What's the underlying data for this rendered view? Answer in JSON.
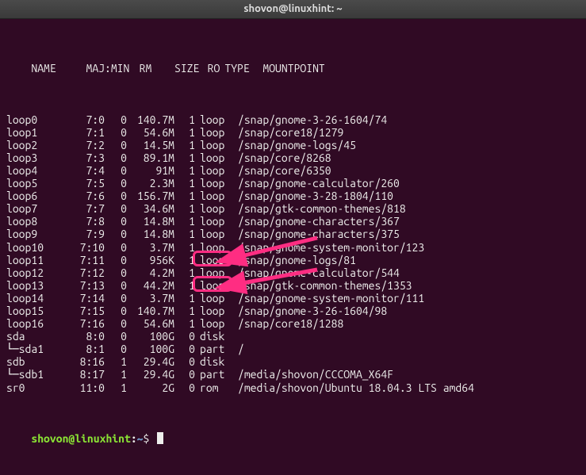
{
  "window": {
    "title": "shovon@linuxhint: ~"
  },
  "header": {
    "name": "NAME",
    "majmin": "MAJ:MIN",
    "rm": "RM",
    "size": "SIZE",
    "ro": "RO",
    "type": "TYPE",
    "mountpoint": "MOUNTPOINT"
  },
  "rows": [
    {
      "name": "loop0",
      "majmin": "7:0",
      "rm": "0",
      "size": "140.7M",
      "ro": "1",
      "type": "loop",
      "mnt": "/snap/gnome-3-26-1604/74"
    },
    {
      "name": "loop1",
      "majmin": "7:1",
      "rm": "0",
      "size": "54.6M",
      "ro": "1",
      "type": "loop",
      "mnt": "/snap/core18/1279"
    },
    {
      "name": "loop2",
      "majmin": "7:2",
      "rm": "0",
      "size": "14.5M",
      "ro": "1",
      "type": "loop",
      "mnt": "/snap/gnome-logs/45"
    },
    {
      "name": "loop3",
      "majmin": "7:3",
      "rm": "0",
      "size": "89.1M",
      "ro": "1",
      "type": "loop",
      "mnt": "/snap/core/8268"
    },
    {
      "name": "loop4",
      "majmin": "7:4",
      "rm": "0",
      "size": "91M",
      "ro": "1",
      "type": "loop",
      "mnt": "/snap/core/6350"
    },
    {
      "name": "loop5",
      "majmin": "7:5",
      "rm": "0",
      "size": "2.3M",
      "ro": "1",
      "type": "loop",
      "mnt": "/snap/gnome-calculator/260"
    },
    {
      "name": "loop6",
      "majmin": "7:6",
      "rm": "0",
      "size": "156.7M",
      "ro": "1",
      "type": "loop",
      "mnt": "/snap/gnome-3-28-1804/110"
    },
    {
      "name": "loop7",
      "majmin": "7:7",
      "rm": "0",
      "size": "34.6M",
      "ro": "1",
      "type": "loop",
      "mnt": "/snap/gtk-common-themes/818"
    },
    {
      "name": "loop8",
      "majmin": "7:8",
      "rm": "0",
      "size": "14.8M",
      "ro": "1",
      "type": "loop",
      "mnt": "/snap/gnome-characters/367"
    },
    {
      "name": "loop9",
      "majmin": "7:9",
      "rm": "0",
      "size": "14.8M",
      "ro": "1",
      "type": "loop",
      "mnt": "/snap/gnome-characters/375"
    },
    {
      "name": "loop10",
      "majmin": "7:10",
      "rm": "0",
      "size": "3.7M",
      "ro": "1",
      "type": "loop",
      "mnt": "/snap/gnome-system-monitor/123"
    },
    {
      "name": "loop11",
      "majmin": "7:11",
      "rm": "0",
      "size": "956K",
      "ro": "1",
      "type": "loop",
      "mnt": "/snap/gnome-logs/81"
    },
    {
      "name": "loop12",
      "majmin": "7:12",
      "rm": "0",
      "size": "4.2M",
      "ro": "1",
      "type": "loop",
      "mnt": "/snap/gnome-calculator/544"
    },
    {
      "name": "loop13",
      "majmin": "7:13",
      "rm": "0",
      "size": "44.2M",
      "ro": "1",
      "type": "loop",
      "mnt": "/snap/gtk-common-themes/1353"
    },
    {
      "name": "loop14",
      "majmin": "7:14",
      "rm": "0",
      "size": "3.7M",
      "ro": "1",
      "type": "loop",
      "mnt": "/snap/gnome-system-monitor/111"
    },
    {
      "name": "loop15",
      "majmin": "7:15",
      "rm": "0",
      "size": "140.7M",
      "ro": "1",
      "type": "loop",
      "mnt": "/snap/gnome-3-26-1604/98"
    },
    {
      "name": "loop16",
      "majmin": "7:16",
      "rm": "0",
      "size": "54.6M",
      "ro": "1",
      "type": "loop",
      "mnt": "/snap/core18/1288"
    },
    {
      "name": "sda",
      "majmin": "8:0",
      "rm": "0",
      "size": "100G",
      "ro": "0",
      "type": "disk",
      "mnt": ""
    },
    {
      "name": "sda1",
      "majmin": "8:1",
      "rm": "0",
      "size": "100G",
      "ro": "0",
      "type": "part",
      "mnt": "/",
      "child": true
    },
    {
      "name": "sdb",
      "majmin": "8:16",
      "rm": "1",
      "size": "29.4G",
      "ro": "0",
      "type": "disk",
      "mnt": ""
    },
    {
      "name": "sdb1",
      "majmin": "8:17",
      "rm": "1",
      "size": "29.4G",
      "ro": "0",
      "type": "part",
      "mnt": "/media/shovon/CCCOMA_X64F",
      "child": true
    },
    {
      "name": "sr0",
      "majmin": "11:0",
      "rm": "1",
      "size": "2G",
      "ro": "0",
      "type": "rom",
      "mnt": "/media/shovon/Ubuntu 18.04.3 LTS amd64"
    }
  ],
  "prompt": {
    "userhost": "shovon@linuxhint",
    "colon": ":",
    "path": "~",
    "dollar": "$"
  },
  "annotation": {
    "highlight_type": "disk"
  }
}
